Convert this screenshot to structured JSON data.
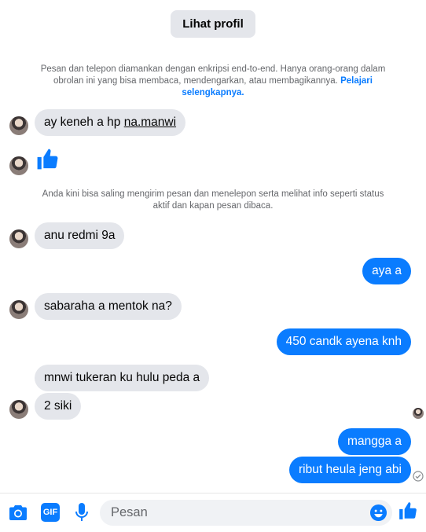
{
  "header": {
    "profile_button": "Lihat profil"
  },
  "encryption_notice": {
    "line1": "Pesan dan telepon diamankan dengan enkripsi end-to-end. Hanya orang-orang dalam",
    "line2_text": "obrolan ini yang bisa membaca, mendengarkan, atau membagikannya.",
    "link_part1": "Pelajari",
    "link_part2": "selengkapnya."
  },
  "messages": [
    {
      "side": "in",
      "pre": "ay keneh a hp ",
      "link": "na.manwi"
    },
    {
      "side": "in",
      "type": "like"
    },
    {
      "side": "in",
      "text": "anu redmi 9a"
    },
    {
      "side": "out",
      "text": "aya a"
    },
    {
      "side": "in",
      "text": "sabaraha a mentok na?"
    },
    {
      "side": "out",
      "text": "450 candk ayena knh"
    },
    {
      "side": "in",
      "text": "mnwi tukeran ku hulu peda a"
    },
    {
      "side": "in",
      "text": "2 siki"
    },
    {
      "side": "out",
      "text": "mangga a"
    },
    {
      "side": "out",
      "text": "ribut heula jeng abi"
    }
  ],
  "system_notice": {
    "line1": "Anda kini bisa saling mengirim pesan dan menelepon serta melihat info seperti status",
    "line2": "aktif dan kapan pesan dibaca."
  },
  "composer": {
    "placeholder": "Pesan",
    "camera_icon": "camera-icon",
    "gif_label": "GIF",
    "mic_icon": "microphone-icon",
    "emoji_icon": "emoji-icon",
    "like_icon": "thumbs-up-icon"
  },
  "colors": {
    "accent": "#0a7cff",
    "incoming_bubble": "#e4e6eb",
    "muted_text": "#65676b"
  }
}
